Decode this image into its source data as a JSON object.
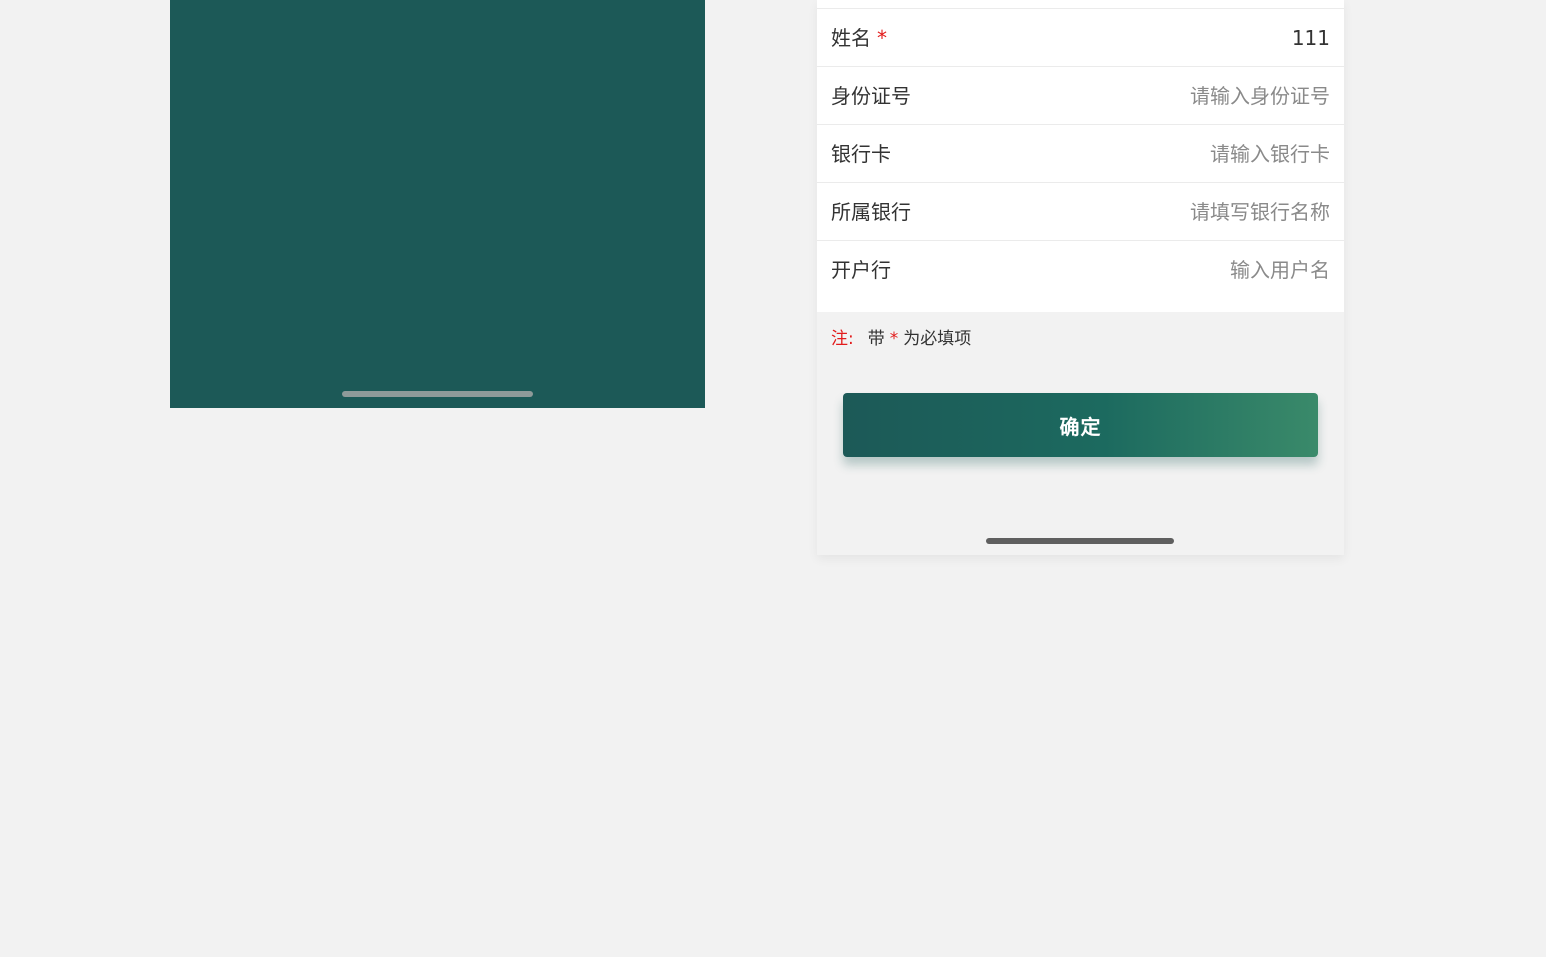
{
  "form": {
    "rows": [
      {
        "label": "姓名",
        "required": "*",
        "value": "111",
        "placeholder": ""
      },
      {
        "label": "身份证号",
        "value": "",
        "placeholder": "请输入身份证号"
      },
      {
        "label": "银行卡",
        "value": "",
        "placeholder": "请输入银行卡"
      },
      {
        "label": "所属银行",
        "value": "",
        "placeholder": "请填写银行名称"
      },
      {
        "label": "开户行",
        "value": "",
        "placeholder": "输入用户名"
      }
    ]
  },
  "note": {
    "prefix": "注:",
    "text_before": "带",
    "star": "*",
    "text_after": "为必填项"
  },
  "confirm_button": {
    "label": "确定"
  },
  "colors": {
    "primary": "#1c5957",
    "gradient_end": "#3a8a6a",
    "required": "#e21b1b",
    "background": "#f2f2f2"
  }
}
